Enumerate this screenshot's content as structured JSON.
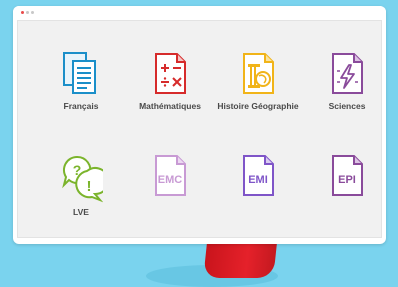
{
  "subjects": [
    {
      "label": "Français",
      "icon": "documents-icon",
      "color": "#1b8fc9"
    },
    {
      "label": "Mathématiques",
      "icon": "math-operators-icon",
      "color": "#d62b2b"
    },
    {
      "label": "Histoire Géographie",
      "icon": "column-globe-icon",
      "color": "#f1b419"
    },
    {
      "label": "Sciences",
      "icon": "lightning-icon",
      "color": "#8a4b9b"
    },
    {
      "label": "LVE",
      "icon": "speech-bubbles-icon",
      "color": "#7bb42c"
    },
    {
      "label": "",
      "icon": "emc-document-icon",
      "color": "#c89ad4",
      "badge": "EMC"
    },
    {
      "label": "",
      "icon": "emi-document-icon",
      "color": "#7f55c8",
      "badge": "EMI"
    },
    {
      "label": "",
      "icon": "epi-document-icon",
      "color": "#8a4b9b",
      "badge": "EPI"
    }
  ],
  "colors": {
    "background": "#7ad3ee",
    "stand": "#e5212a",
    "window": "#ffffff",
    "screen": "#f1f1f1"
  }
}
